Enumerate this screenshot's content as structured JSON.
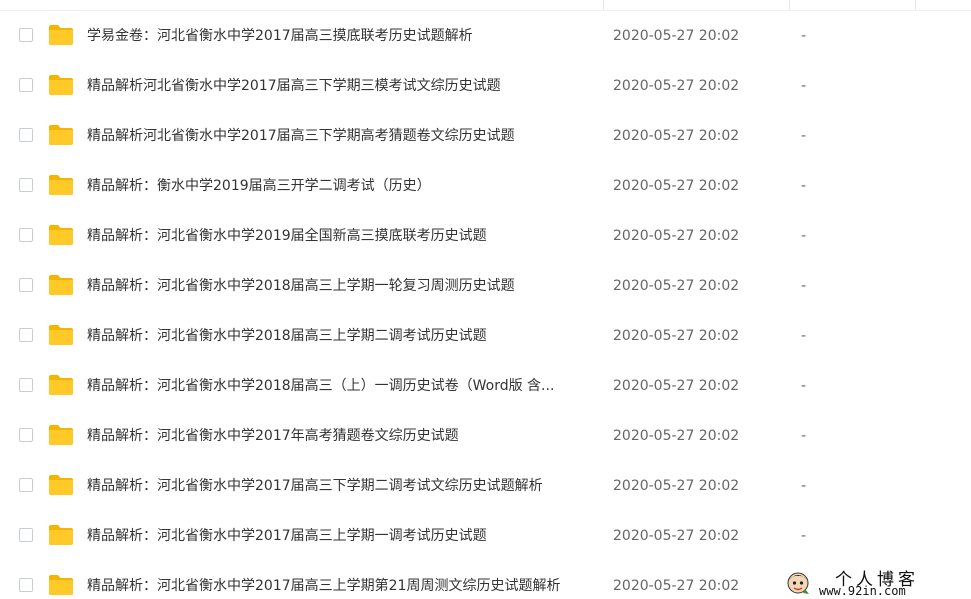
{
  "files": [
    {
      "name": "学易金卷：河北省衡水中学2017届高三摸底联考历史试题解析",
      "date": "2020-05-27 20:02",
      "size": "-"
    },
    {
      "name": "精品解析河北省衡水中学2017届高三下学期三模考试文综历史试题",
      "date": "2020-05-27 20:02",
      "size": "-"
    },
    {
      "name": "精品解析河北省衡水中学2017届高三下学期高考猜题卷文综历史试题",
      "date": "2020-05-27 20:02",
      "size": "-"
    },
    {
      "name": "精品解析：衡水中学2019届高三开学二调考试（历史）",
      "date": "2020-05-27 20:02",
      "size": "-"
    },
    {
      "name": "精品解析：河北省衡水中学2019届全国新高三摸底联考历史试题",
      "date": "2020-05-27 20:02",
      "size": "-"
    },
    {
      "name": "精品解析：河北省衡水中学2018届高三上学期一轮复习周测历史试题",
      "date": "2020-05-27 20:02",
      "size": "-"
    },
    {
      "name": "精品解析：河北省衡水中学2018届高三上学期二调考试历史试题",
      "date": "2020-05-27 20:02",
      "size": "-"
    },
    {
      "name": "精品解析：河北省衡水中学2018届高三（上）一调历史试卷（Word版 含...",
      "date": "2020-05-27 20:02",
      "size": "-"
    },
    {
      "name": "精品解析：河北省衡水中学2017年高考猜题卷文综历史试题",
      "date": "2020-05-27 20:02",
      "size": "-"
    },
    {
      "name": "精品解析：河北省衡水中学2017届高三下学期二调考试文综历史试题解析",
      "date": "2020-05-27 20:02",
      "size": "-"
    },
    {
      "name": "精品解析：河北省衡水中学2017届高三上学期一调考试历史试题",
      "date": "2020-05-27 20:02",
      "size": "-"
    },
    {
      "name": "精品解析：河北省衡水中学2017届高三上学期第21周周测文综历史试题解析",
      "date": "2020-05-27 20:02",
      "size": "-"
    }
  ],
  "watermark": {
    "title": "个人博客",
    "url": "www.92in.com"
  },
  "colors": {
    "folder": "#FFC928",
    "folder_tab": "#F5B400"
  },
  "icons": {
    "folder": "folder-icon",
    "checkbox": "checkbox-icon",
    "avatar": "avatar-icon"
  }
}
